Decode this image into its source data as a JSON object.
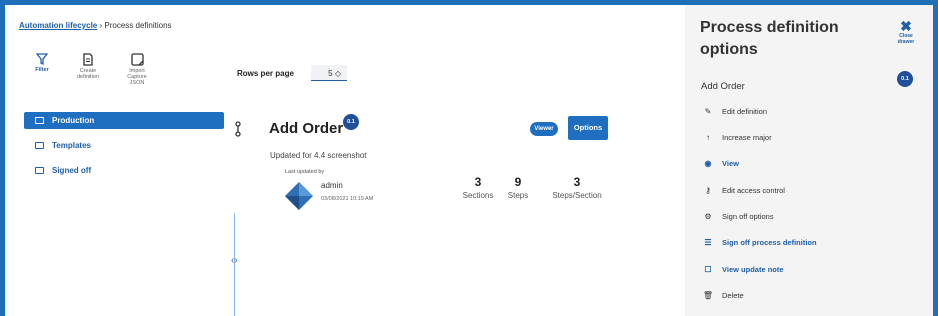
{
  "breadcrumb": {
    "link": "Automation lifecycle",
    "separator": "›",
    "current": "Process definitions"
  },
  "toolbar": {
    "filter": "Filter",
    "create": [
      "Create",
      "definition"
    ],
    "import": [
      "Import",
      "Capture",
      "JSON"
    ]
  },
  "rows_per_page": {
    "label": "Rows per page",
    "value": "5 ◇"
  },
  "folders": [
    {
      "label": "Production",
      "active": true
    },
    {
      "label": "Templates",
      "active": false
    },
    {
      "label": "Signed off",
      "active": false
    }
  ],
  "definition": {
    "title": "Add Order",
    "version": "0.1",
    "viewer_label": "Viewer",
    "options_label": "Options",
    "description": "Updated for 4.4 screenshot",
    "last_updated_label": "Last updated by",
    "user": "admin",
    "date": "03/08/2021 10:19 AM",
    "stats": [
      {
        "value": "3",
        "label": "Sections"
      },
      {
        "value": "9",
        "label": "Steps"
      },
      {
        "value": "3",
        "label": "Steps/Section"
      }
    ]
  },
  "drawer": {
    "title": "Process definition options",
    "close_label": [
      "Close",
      "drawer"
    ],
    "subtitle": "Add Order",
    "version": "0.1",
    "items": [
      {
        "label": "Edit definition",
        "icon": "pencil-icon",
        "glyph": "✎",
        "accent": false
      },
      {
        "label": "Increase major",
        "icon": "arrow-up-icon",
        "glyph": "↑",
        "accent": false
      },
      {
        "label": "View",
        "icon": "eye-icon",
        "glyph": "◉",
        "accent": true
      },
      {
        "label": "Edit access control",
        "icon": "key-person-icon",
        "glyph": "⚷",
        "accent": false
      },
      {
        "label": "Sign off options",
        "icon": "users-gear-icon",
        "glyph": "⚙",
        "accent": false
      },
      {
        "label": "Sign off process definition",
        "icon": "document-check-icon",
        "glyph": "☰",
        "accent": true
      },
      {
        "label": "View update note",
        "icon": "note-icon",
        "glyph": "☐",
        "accent": true
      },
      {
        "label": "Delete",
        "icon": "trash-icon",
        "glyph": "🗑",
        "accent": false
      }
    ]
  },
  "colors": {
    "accent": "#1f6fc0",
    "link": "#1f5fa8",
    "border": "#1e6fb8",
    "badge": "#1f4f99"
  }
}
